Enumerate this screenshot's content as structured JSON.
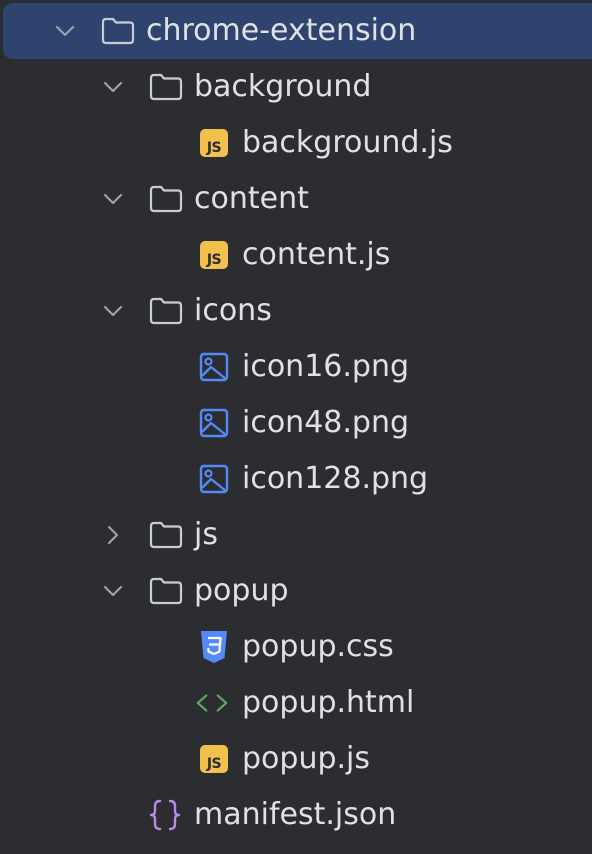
{
  "tree": {
    "root": {
      "label": "chrome-extension",
      "expanded": true,
      "selected": true,
      "icon": "folder-icon"
    },
    "items": [
      {
        "label": "background",
        "type": "folder",
        "expanded": true,
        "icon": "folder-icon"
      },
      {
        "label": "background.js",
        "type": "file",
        "icon": "javascript-file-icon",
        "badge": "JS"
      },
      {
        "label": "content",
        "type": "folder",
        "expanded": true,
        "icon": "folder-icon"
      },
      {
        "label": "content.js",
        "type": "file",
        "icon": "javascript-file-icon",
        "badge": "JS"
      },
      {
        "label": "icons",
        "type": "folder",
        "expanded": true,
        "icon": "folder-icon"
      },
      {
        "label": "icon16.png",
        "type": "file",
        "icon": "image-file-icon"
      },
      {
        "label": "icon48.png",
        "type": "file",
        "icon": "image-file-icon"
      },
      {
        "label": "icon128.png",
        "type": "file",
        "icon": "image-file-icon"
      },
      {
        "label": "js",
        "type": "folder",
        "expanded": false,
        "icon": "folder-icon"
      },
      {
        "label": "popup",
        "type": "folder",
        "expanded": true,
        "icon": "folder-icon"
      },
      {
        "label": "popup.css",
        "type": "file",
        "icon": "css-file-icon"
      },
      {
        "label": "popup.html",
        "type": "file",
        "icon": "html-file-icon"
      },
      {
        "label": "popup.js",
        "type": "file",
        "icon": "javascript-file-icon",
        "badge": "JS"
      },
      {
        "label": "manifest.json",
        "type": "file",
        "icon": "json-file-icon"
      }
    ]
  },
  "colors": {
    "background": "#2b2d30",
    "selection": "#2e436e",
    "text": "#dfe1e5",
    "chevron": "#9da0a8",
    "folder_stroke": "#c9ccd3",
    "js_badge": "#f0c14c",
    "image_icon": "#548af7",
    "css_icon": "#548af7",
    "html_icon": "#5fa35f",
    "json_icon": "#b58ae8"
  }
}
